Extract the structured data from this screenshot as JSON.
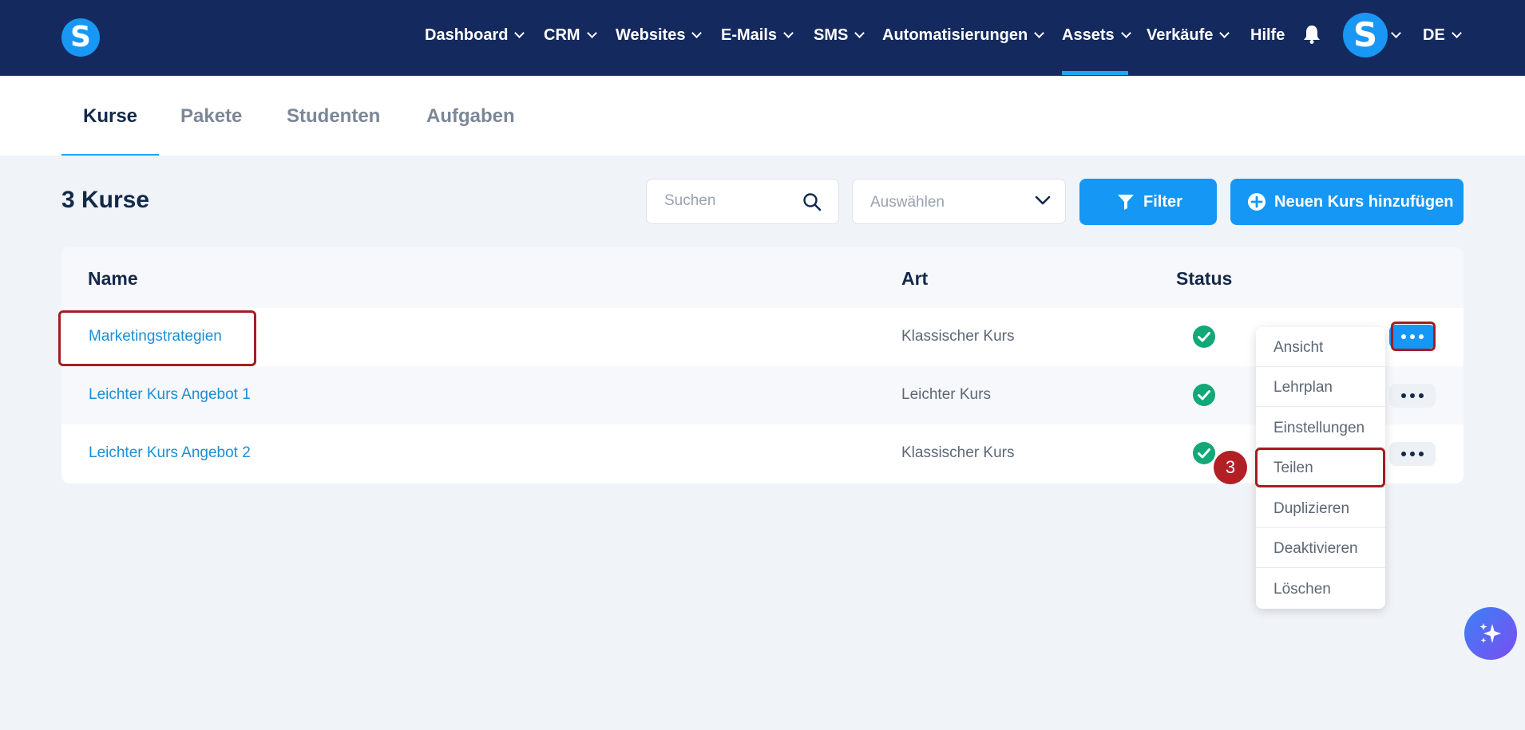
{
  "app": {
    "logo_letter": "S"
  },
  "nav": {
    "items": [
      {
        "label": "Dashboard",
        "has_menu": true
      },
      {
        "label": "CRM",
        "has_menu": true
      },
      {
        "label": "Websites",
        "has_menu": true
      },
      {
        "label": "E-Mails",
        "has_menu": true
      },
      {
        "label": "SMS",
        "has_menu": true
      },
      {
        "label": "Automatisierungen",
        "has_menu": true
      },
      {
        "label": "Assets",
        "has_menu": true,
        "active": true
      },
      {
        "label": "Verkäufe",
        "has_menu": true
      },
      {
        "label": "Hilfe",
        "has_menu": false
      }
    ],
    "avatar_letter": "S",
    "language": "DE"
  },
  "subtabs": {
    "items": [
      {
        "label": "Kurse",
        "active": true
      },
      {
        "label": "Pakete"
      },
      {
        "label": "Studenten"
      },
      {
        "label": "Aufgaben"
      }
    ]
  },
  "toolbar": {
    "count_title": "3 Kurse",
    "search_placeholder": "Suchen",
    "select_placeholder": "Auswählen",
    "filter_label": "Filter",
    "add_label": "Neuen Kurs hinzufügen"
  },
  "table": {
    "headers": {
      "name": "Name",
      "art": "Art",
      "status": "Status"
    },
    "rows": [
      {
        "name": "Marketingstrategien",
        "art": "Klassischer Kurs",
        "status": "active"
      },
      {
        "name": "Leichter Kurs Angebot 1",
        "art": "Leichter Kurs",
        "status": "active"
      },
      {
        "name": "Leichter Kurs Angebot 2",
        "art": "Klassischer Kurs",
        "status": "active"
      }
    ]
  },
  "menu": {
    "items": [
      "Ansicht",
      "Lehrplan",
      "Einstellungen",
      "Teilen",
      "Duplizieren",
      "Deaktivieren",
      "Löschen"
    ]
  },
  "annotation": {
    "step_number": "3"
  },
  "colors": {
    "nav_bg": "#142a5e",
    "accent": "#1497f5",
    "highlight": "#a51d22",
    "status_ok": "#12a877"
  }
}
